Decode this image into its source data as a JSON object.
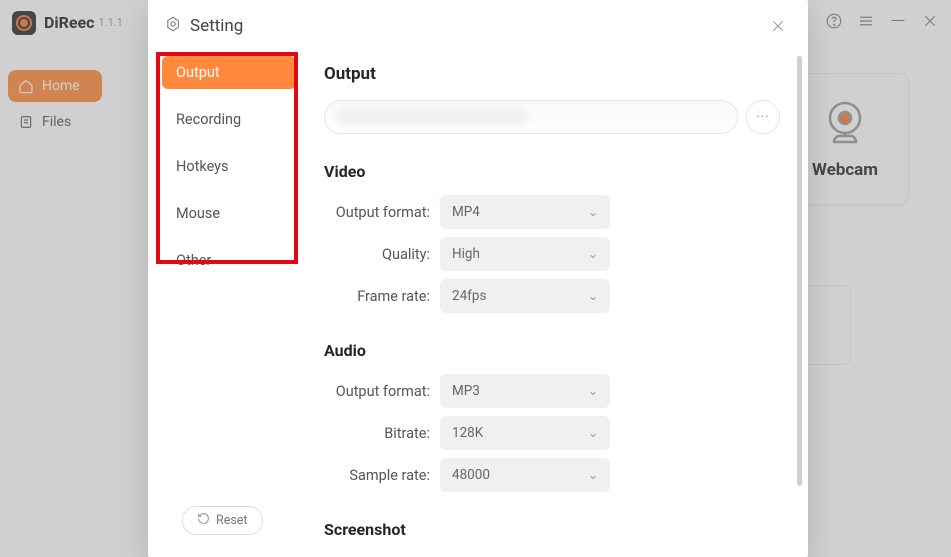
{
  "app": {
    "name": "DiReec",
    "version": "1.1.1",
    "sidebar": {
      "home": "Home",
      "files": "Files"
    },
    "webcam_card": "Webcam"
  },
  "modal": {
    "title": "Setting",
    "nav": {
      "output": "Output",
      "recording": "Recording",
      "hotkeys": "Hotkeys",
      "mouse": "Mouse",
      "other": "Other"
    },
    "reset": "Reset",
    "content": {
      "output_heading": "Output",
      "video_heading": "Video",
      "audio_heading": "Audio",
      "screenshot_heading": "Screenshot",
      "labels": {
        "output_format": "Output format:",
        "quality": "Quality:",
        "frame_rate": "Frame rate:",
        "bitrate": "Bitrate:",
        "sample_rate": "Sample rate:"
      },
      "values": {
        "video_format": "MP4",
        "video_quality": "High",
        "video_fps": "24fps",
        "audio_format": "MP3",
        "audio_bitrate": "128K",
        "audio_sample": "48000"
      },
      "path_more": "···"
    }
  }
}
